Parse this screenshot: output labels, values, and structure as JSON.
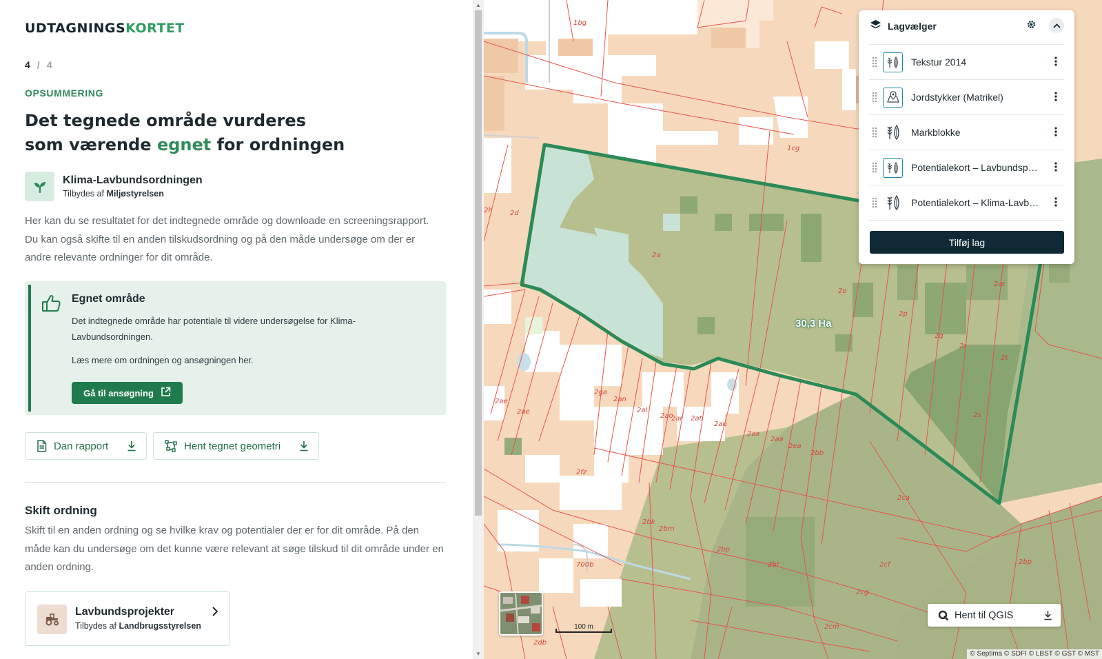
{
  "app": {
    "logo_part1": "UDTAGNINGS",
    "logo_part2": "KORTET",
    "brand_color": "#2f9c63"
  },
  "stepper": {
    "current": "4",
    "separator": "/",
    "total": "4"
  },
  "summary": {
    "eyebrow": "OPSUMMERING",
    "headline_part1": "Det tegnede område vurderes",
    "headline_part2": "som værende",
    "headline_highlight": "egnet",
    "headline_part3": "for ordningen"
  },
  "scheme": {
    "name": "Klima-Lavbundsordningen",
    "offered_by_prefix": "Tilbydes af",
    "offered_by": "Miljøstyrelsen",
    "icon": "sprout-icon"
  },
  "intro_text": "Her kan du se resultatet for det indtegnede område og downloade en screeningsrapport. Du kan også skifte til en anden tilskudsordning og på den måde undersøge om der er andre relevante ordninger for dit område.",
  "result": {
    "title": "Egnet område",
    "body": "Det indtegnede område har potentiale til videre undersøgelse for Klima-Lavbundsordningen.",
    "more": "Læs mere om ordningen og ansøgningen her.",
    "cta": "Gå til ansøgning",
    "icon": "thumbs-up-icon"
  },
  "downloads": {
    "report": "Dan rapport",
    "geometry": "Hent tegnet geometri"
  },
  "switch": {
    "title": "Skift ordning",
    "text": "Skift til en anden ordning og se hvilke krav og potentialer der er for dit område. På den måde kan du undersøge om det kunne være relevant at søge tilskud til dit område under en anden ordning.",
    "card_name": "Lavbundsprojekter",
    "card_by_prefix": "Tilbydes af",
    "card_by": "Landbrugsstyrelsen",
    "card_icon": "tractor-icon"
  },
  "map": {
    "area_label": "30,3 Ha",
    "scale_label": "100 m",
    "qgis_button": "Hent til QGIS",
    "attribution": "© Septima © SDFI © LBST © GST © MST",
    "parcel_labels": [
      "1bg",
      "1cg",
      "2d",
      "2a",
      "2o",
      "2p",
      "2q",
      "2r",
      "2t",
      "2s",
      "2æ",
      "2ga",
      "2an",
      "2al",
      "2ao",
      "2ar",
      "2at",
      "2au",
      "2ax",
      "2aa",
      "2ea",
      "2bb",
      "2ae",
      "2fz",
      "2bk",
      "2bm",
      "2bp",
      "2bt",
      "2ca",
      "2cf",
      "2cg",
      "2cm",
      "2bp",
      "2db",
      "700b",
      "2ae",
      "2h"
    ],
    "outline_color": "#2b8a57",
    "parcel_line_color": "#e8524a"
  },
  "layer_panel": {
    "title": "Lagvælger",
    "add_button": "Tilføj lag",
    "layers": [
      {
        "name": "Tekstur 2014",
        "icon": "texture-icon"
      },
      {
        "name": "Jordstykker (Matrikel)",
        "icon": "parcel-icon"
      },
      {
        "name": "Markblokke",
        "icon": "crop-icon"
      },
      {
        "name": "Potentialekort – Lavbundsprojekter",
        "icon": "potential-icon"
      },
      {
        "name": "Potentialekort – Klima-Lavbundsordningen",
        "icon": "crop-icon"
      }
    ]
  }
}
